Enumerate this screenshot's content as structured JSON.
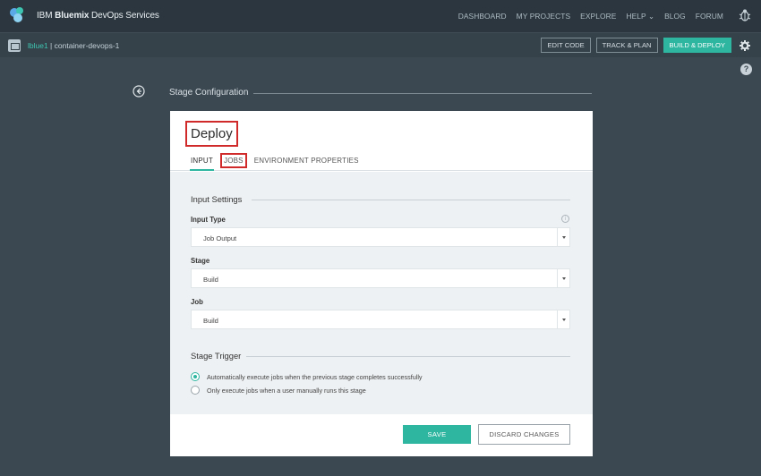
{
  "app": {
    "brand_prefix": "IBM ",
    "brand_bold": "Bluemix",
    "brand_suffix": " DevOps Services"
  },
  "nav": {
    "items": [
      "DASHBOARD",
      "MY PROJECTS",
      "EXPLORE",
      "HELP ⌄",
      "BLOG",
      "FORUM"
    ]
  },
  "project": {
    "owner": "lblue1",
    "separator": " | ",
    "name": "container-devops-1",
    "actions": [
      "EDIT CODE",
      "TRACK & PLAN",
      "BUILD & DEPLOY"
    ]
  },
  "help_glyph": "?",
  "stage": {
    "title": "Stage Configuration"
  },
  "panel": {
    "title": "Deploy",
    "tabs": [
      "INPUT",
      "JOBS",
      "ENVIRONMENT PROPERTIES"
    ],
    "input_settings_title": "Input Settings",
    "info_glyph": "i",
    "fields": [
      {
        "label": "Input Type",
        "value": "Job Output"
      },
      {
        "label": "Stage",
        "value": "Build"
      },
      {
        "label": "Job",
        "value": "Build"
      }
    ],
    "trigger_title": "Stage Trigger",
    "trigger_options": [
      "Automatically execute jobs when the previous stage completes successfully",
      "Only execute jobs when a user manually runs this stage"
    ],
    "trigger_selected": 0,
    "save_label": "SAVE",
    "discard_label": "DISCARD CHANGES"
  },
  "colors": {
    "accent": "#2fb6a1",
    "highlight": "#d02a2a",
    "background": "#3c4851",
    "topbar": "#2b363e"
  }
}
